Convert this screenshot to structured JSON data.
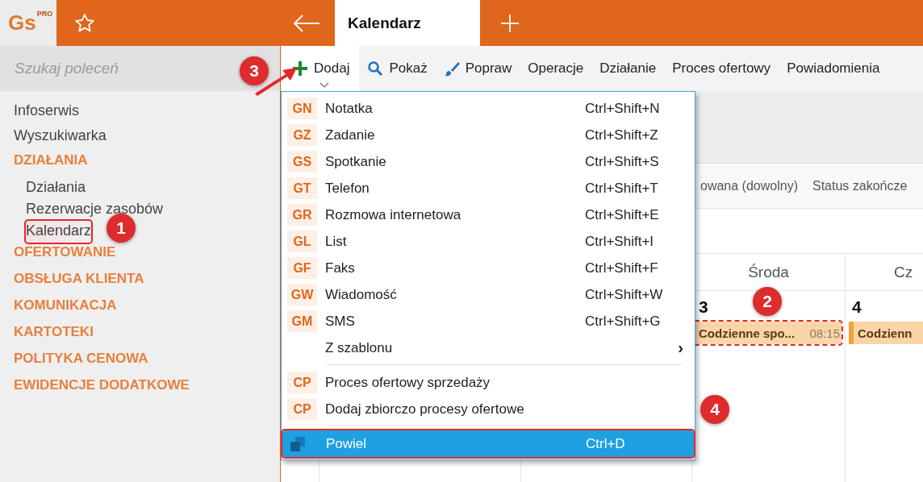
{
  "app": {
    "logo": "Gs",
    "logo_badge": "PRO"
  },
  "tabs": [
    {
      "label": "Kalendarz",
      "selected": true
    }
  ],
  "search": {
    "placeholder": "Szukaj poleceń"
  },
  "toolbar": [
    {
      "label": "Dodaj",
      "open": true
    },
    {
      "label": "Pokaż",
      "open": false
    },
    {
      "label": "Popraw",
      "open": false
    },
    {
      "label": "Operacje",
      "open": false
    },
    {
      "label": "Działanie",
      "open": false
    },
    {
      "label": "Proces ofertowy",
      "open": false
    },
    {
      "label": "Powiadomienia",
      "open": false
    }
  ],
  "sidebar": {
    "items": [
      {
        "label": "Infoserwis",
        "kind": "link"
      },
      {
        "label": "Wyszukiwarka",
        "kind": "link"
      },
      {
        "label": "DZIAŁANIA",
        "kind": "section",
        "children": [
          {
            "label": "Działania",
            "highlighted": false
          },
          {
            "label": "Rezerwacje zasobów",
            "highlighted": false
          },
          {
            "label": "Kalendarz",
            "highlighted": true
          }
        ]
      },
      {
        "label": "OFERTOWANIE",
        "kind": "section"
      },
      {
        "label": "OBSŁUGA KLIENTA",
        "kind": "section"
      },
      {
        "label": "KOMUNIKACJA",
        "kind": "section"
      },
      {
        "label": "KARTOTEKI",
        "kind": "section"
      },
      {
        "label": "POLITYKA CENOWA",
        "kind": "section"
      },
      {
        "label": "EWIDENCJE DODATKOWE",
        "kind": "section"
      }
    ]
  },
  "menu": [
    {
      "kind": "item",
      "badge": "GN",
      "label": "Notatka",
      "shortcut": "Ctrl+Shift+N",
      "selected": false,
      "highlighted": false
    },
    {
      "kind": "item",
      "badge": "GZ",
      "label": "Zadanie",
      "shortcut": "Ctrl+Shift+Z",
      "selected": false,
      "highlighted": false
    },
    {
      "kind": "item",
      "badge": "GS",
      "label": "Spotkanie",
      "shortcut": "Ctrl+Shift+S",
      "selected": false,
      "highlighted": false
    },
    {
      "kind": "item",
      "badge": "GT",
      "label": "Telefon",
      "shortcut": "Ctrl+Shift+T",
      "selected": false,
      "highlighted": false
    },
    {
      "kind": "item",
      "badge": "GR",
      "label": "Rozmowa internetowa",
      "shortcut": "Ctrl+Shift+E",
      "selected": false,
      "highlighted": false
    },
    {
      "kind": "item",
      "badge": "GL",
      "label": "List",
      "shortcut": "Ctrl+Shift+I",
      "selected": false,
      "highlighted": false
    },
    {
      "kind": "item",
      "badge": "GF",
      "label": "Faks",
      "shortcut": "Ctrl+Shift+F",
      "selected": false,
      "highlighted": false
    },
    {
      "kind": "item",
      "badge": "GW",
      "label": "Wiadomość",
      "shortcut": "Ctrl+Shift+W",
      "selected": false,
      "highlighted": false
    },
    {
      "kind": "item",
      "badge": "GM",
      "label": "SMS",
      "shortcut": "Ctrl+Shift+G",
      "selected": false,
      "highlighted": false
    },
    {
      "kind": "submenu",
      "label": "Z szablonu",
      "arrow": "›",
      "selected": false,
      "highlighted": false
    },
    {
      "kind": "separator"
    },
    {
      "kind": "item",
      "badge": "CP",
      "label": "Proces ofertowy sprzedaży",
      "selected": false,
      "highlighted": false
    },
    {
      "kind": "item",
      "badge": "CP",
      "label": "Dodaj zbiorczo procesy ofertowe",
      "selected": false,
      "highlighted": false
    },
    {
      "kind": "separator"
    },
    {
      "kind": "action",
      "label": "Powiel",
      "shortcut": "Ctrl+D",
      "selected": true,
      "highlighted": true
    }
  ],
  "calendar": {
    "filters": [
      "owana (dowolny)",
      "Status zakończe"
    ],
    "columns": [
      {
        "label": "Środa",
        "day": "3",
        "events": [
          {
            "title": "Codzienne spo...",
            "time": "08:15",
            "highlighted": true
          }
        ]
      },
      {
        "label": "Cz",
        "day": "4",
        "events": [
          {
            "title": "Codzienn",
            "highlighted": false
          }
        ]
      }
    ]
  },
  "callouts": [
    {
      "label": "1"
    },
    {
      "label": "2"
    },
    {
      "label": "3"
    },
    {
      "label": "4"
    }
  ]
}
